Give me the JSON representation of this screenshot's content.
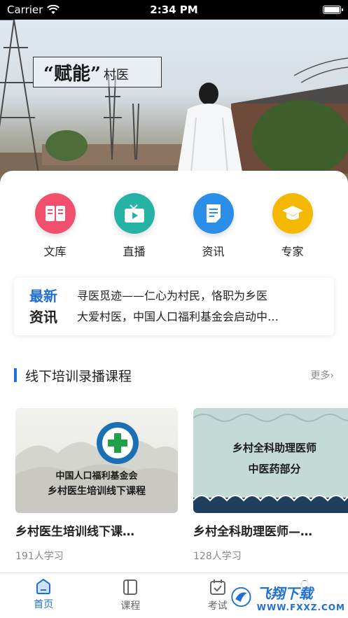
{
  "status": {
    "carrier": "Carrier",
    "time": "2:34 PM"
  },
  "hero": {
    "caption_big": "“赋能”",
    "caption_small": "村医"
  },
  "quick": [
    {
      "label": "文库",
      "icon": "book-icon",
      "color": "#f0506e"
    },
    {
      "label": "直播",
      "icon": "tv-play-icon",
      "color": "#26b3a3"
    },
    {
      "label": "资讯",
      "icon": "document-icon",
      "color": "#2b8fe8"
    },
    {
      "label": "专家",
      "icon": "graduation-cap-icon",
      "color": "#f5b800"
    }
  ],
  "news": {
    "badge_line1": "最新",
    "badge_line2": "资讯",
    "items": [
      "寻医觅迹——仁心为村民，恪职为乡医",
      "大爱村医，中国人口福利基金会启动中…"
    ]
  },
  "section": {
    "title": "线下培训录播课程",
    "more": "更多›"
  },
  "courses": [
    {
      "title": "乡村医生培训线下课…",
      "count": "191人学习",
      "thumb_line1": "中国人口福利基金会",
      "thumb_line2": "乡村医生培训线下课程"
    },
    {
      "title": "乡村全科助理医师—…",
      "count": "128人学习",
      "thumb_line1": "乡村全科助理医师",
      "thumb_line2": "中医药部分"
    }
  ],
  "tabs": [
    {
      "label": "首页",
      "icon": "home-icon",
      "active": true
    },
    {
      "label": "课程",
      "icon": "course-book-icon",
      "active": false
    },
    {
      "label": "考试",
      "icon": "exam-calendar-icon",
      "active": false
    },
    {
      "label": "我的",
      "icon": "profile-icon",
      "active": false
    }
  ],
  "watermark": {
    "text": "飞翔下载",
    "sub": "WWW.FXXZ.COM"
  },
  "colors": {
    "accent": "#1f6fd6"
  }
}
